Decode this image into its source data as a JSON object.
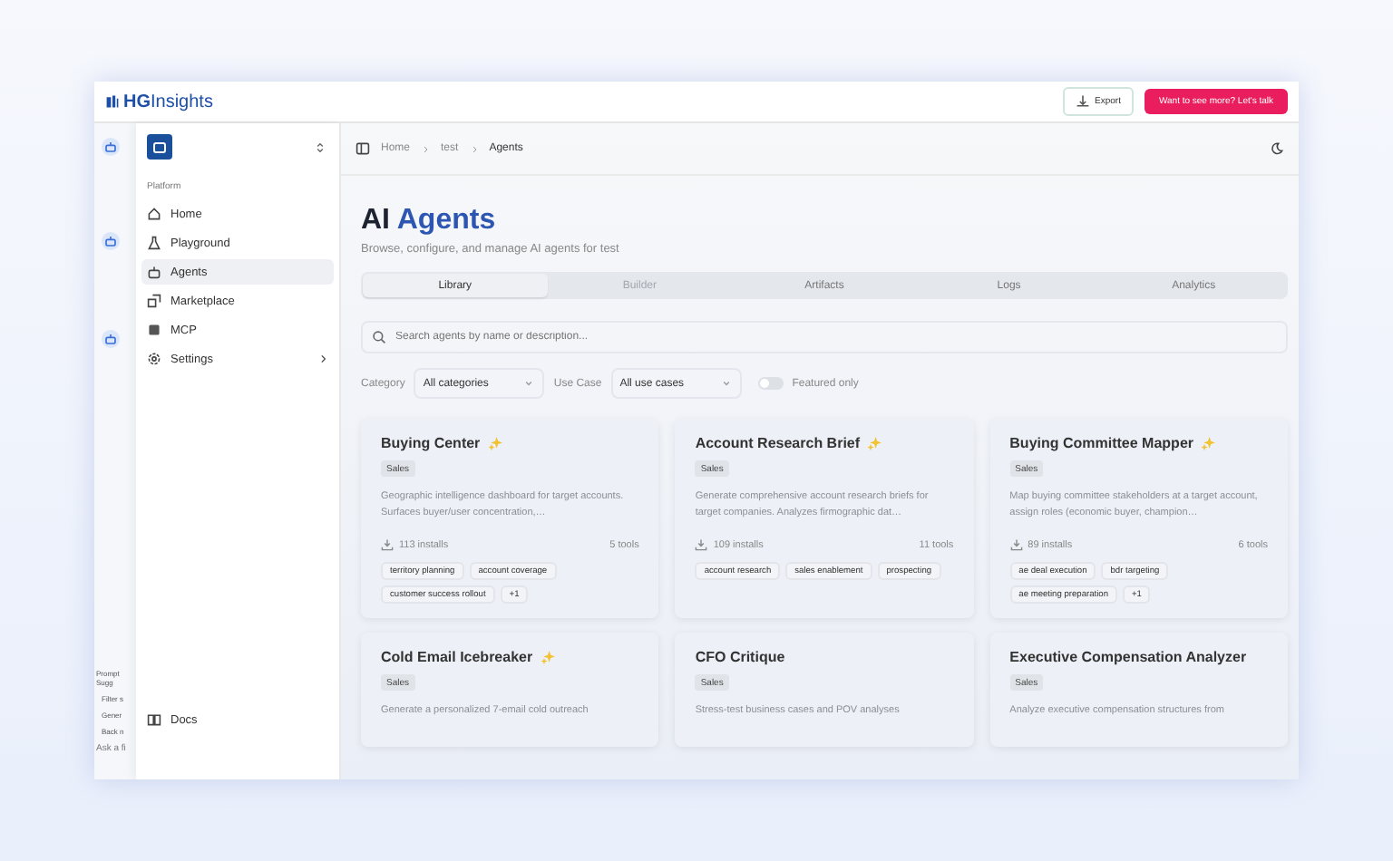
{
  "topbar": {
    "logo_bold": "HG",
    "logo_rest": "Insights",
    "export": "Export",
    "cta": "Want to see more? Let's talk"
  },
  "assistant_strip": {
    "heading": "Prompt Sugg",
    "suggestions": [
      "Filter s",
      "Gener",
      "Back n"
    ],
    "input_placeholder": "Ask a fi"
  },
  "sidebar": {
    "section": "Platform",
    "items": [
      {
        "label": "Home",
        "selected": false,
        "chevron": false
      },
      {
        "label": "Playground",
        "selected": false,
        "chevron": false
      },
      {
        "label": "Agents",
        "selected": true,
        "chevron": false
      },
      {
        "label": "Marketplace",
        "selected": false,
        "chevron": false
      },
      {
        "label": "MCP",
        "selected": false,
        "chevron": false
      },
      {
        "label": "Settings",
        "selected": false,
        "chevron": true
      }
    ],
    "footer": "Docs"
  },
  "breadcrumb": [
    "Home",
    "test",
    "Agents"
  ],
  "title_plain": "AI",
  "title_accent": "Agents",
  "subtitle": "Browse, configure, and manage AI agents for test",
  "tabs": [
    {
      "label": "Library",
      "selected": true,
      "disabled": false
    },
    {
      "label": "Builder",
      "selected": false,
      "disabled": true
    },
    {
      "label": "Artifacts",
      "selected": false,
      "disabled": false
    },
    {
      "label": "Logs",
      "selected": false,
      "disabled": false
    },
    {
      "label": "Analytics",
      "selected": false,
      "disabled": false
    }
  ],
  "search": {
    "placeholder": "Search agents by name or description..."
  },
  "filters": [
    {
      "label": "Category",
      "value": "All categories"
    },
    {
      "label": "Use Case",
      "value": "All use cases"
    }
  ],
  "featured_toggle": {
    "label": "Featured only",
    "on": false
  },
  "cards": [
    {
      "title": "Buying Center",
      "featured": true,
      "badge": "Sales",
      "description": "Geographic intelligence dashboard for target accounts. Surfaces buyer/user concentration,…",
      "installs": "113 installs",
      "tools": "5 tools",
      "tags": [
        "territory planning",
        "account coverage",
        "customer success rollout",
        "+1"
      ]
    },
    {
      "title": "Account Research Brief",
      "featured": true,
      "badge": "Sales",
      "description": "Generate comprehensive account research briefs for target companies. Analyzes firmographic dat…",
      "installs": "109 installs",
      "tools": "11 tools",
      "tags": [
        "account research",
        "sales enablement",
        "prospecting"
      ]
    },
    {
      "title": "Buying Committee Mapper",
      "featured": true,
      "badge": "Sales",
      "description": "Map buying committee stakeholders at a target account, assign roles (economic buyer, champion…",
      "installs": "89 installs",
      "tools": "6 tools",
      "tags": [
        "ae deal execution",
        "bdr targeting",
        "ae meeting preparation",
        "+1"
      ]
    },
    {
      "title": "Cold Email Icebreaker",
      "featured": true,
      "badge": "Sales",
      "description": "Generate a personalized 7-email cold outreach"
    },
    {
      "title": "CFO Critique",
      "featured": false,
      "badge": "Sales",
      "description": "Stress-test business cases and POV analyses"
    },
    {
      "title": "Executive Compensation Analyzer",
      "featured": false,
      "badge": "Sales",
      "description": "Analyze executive compensation structures from"
    }
  ]
}
